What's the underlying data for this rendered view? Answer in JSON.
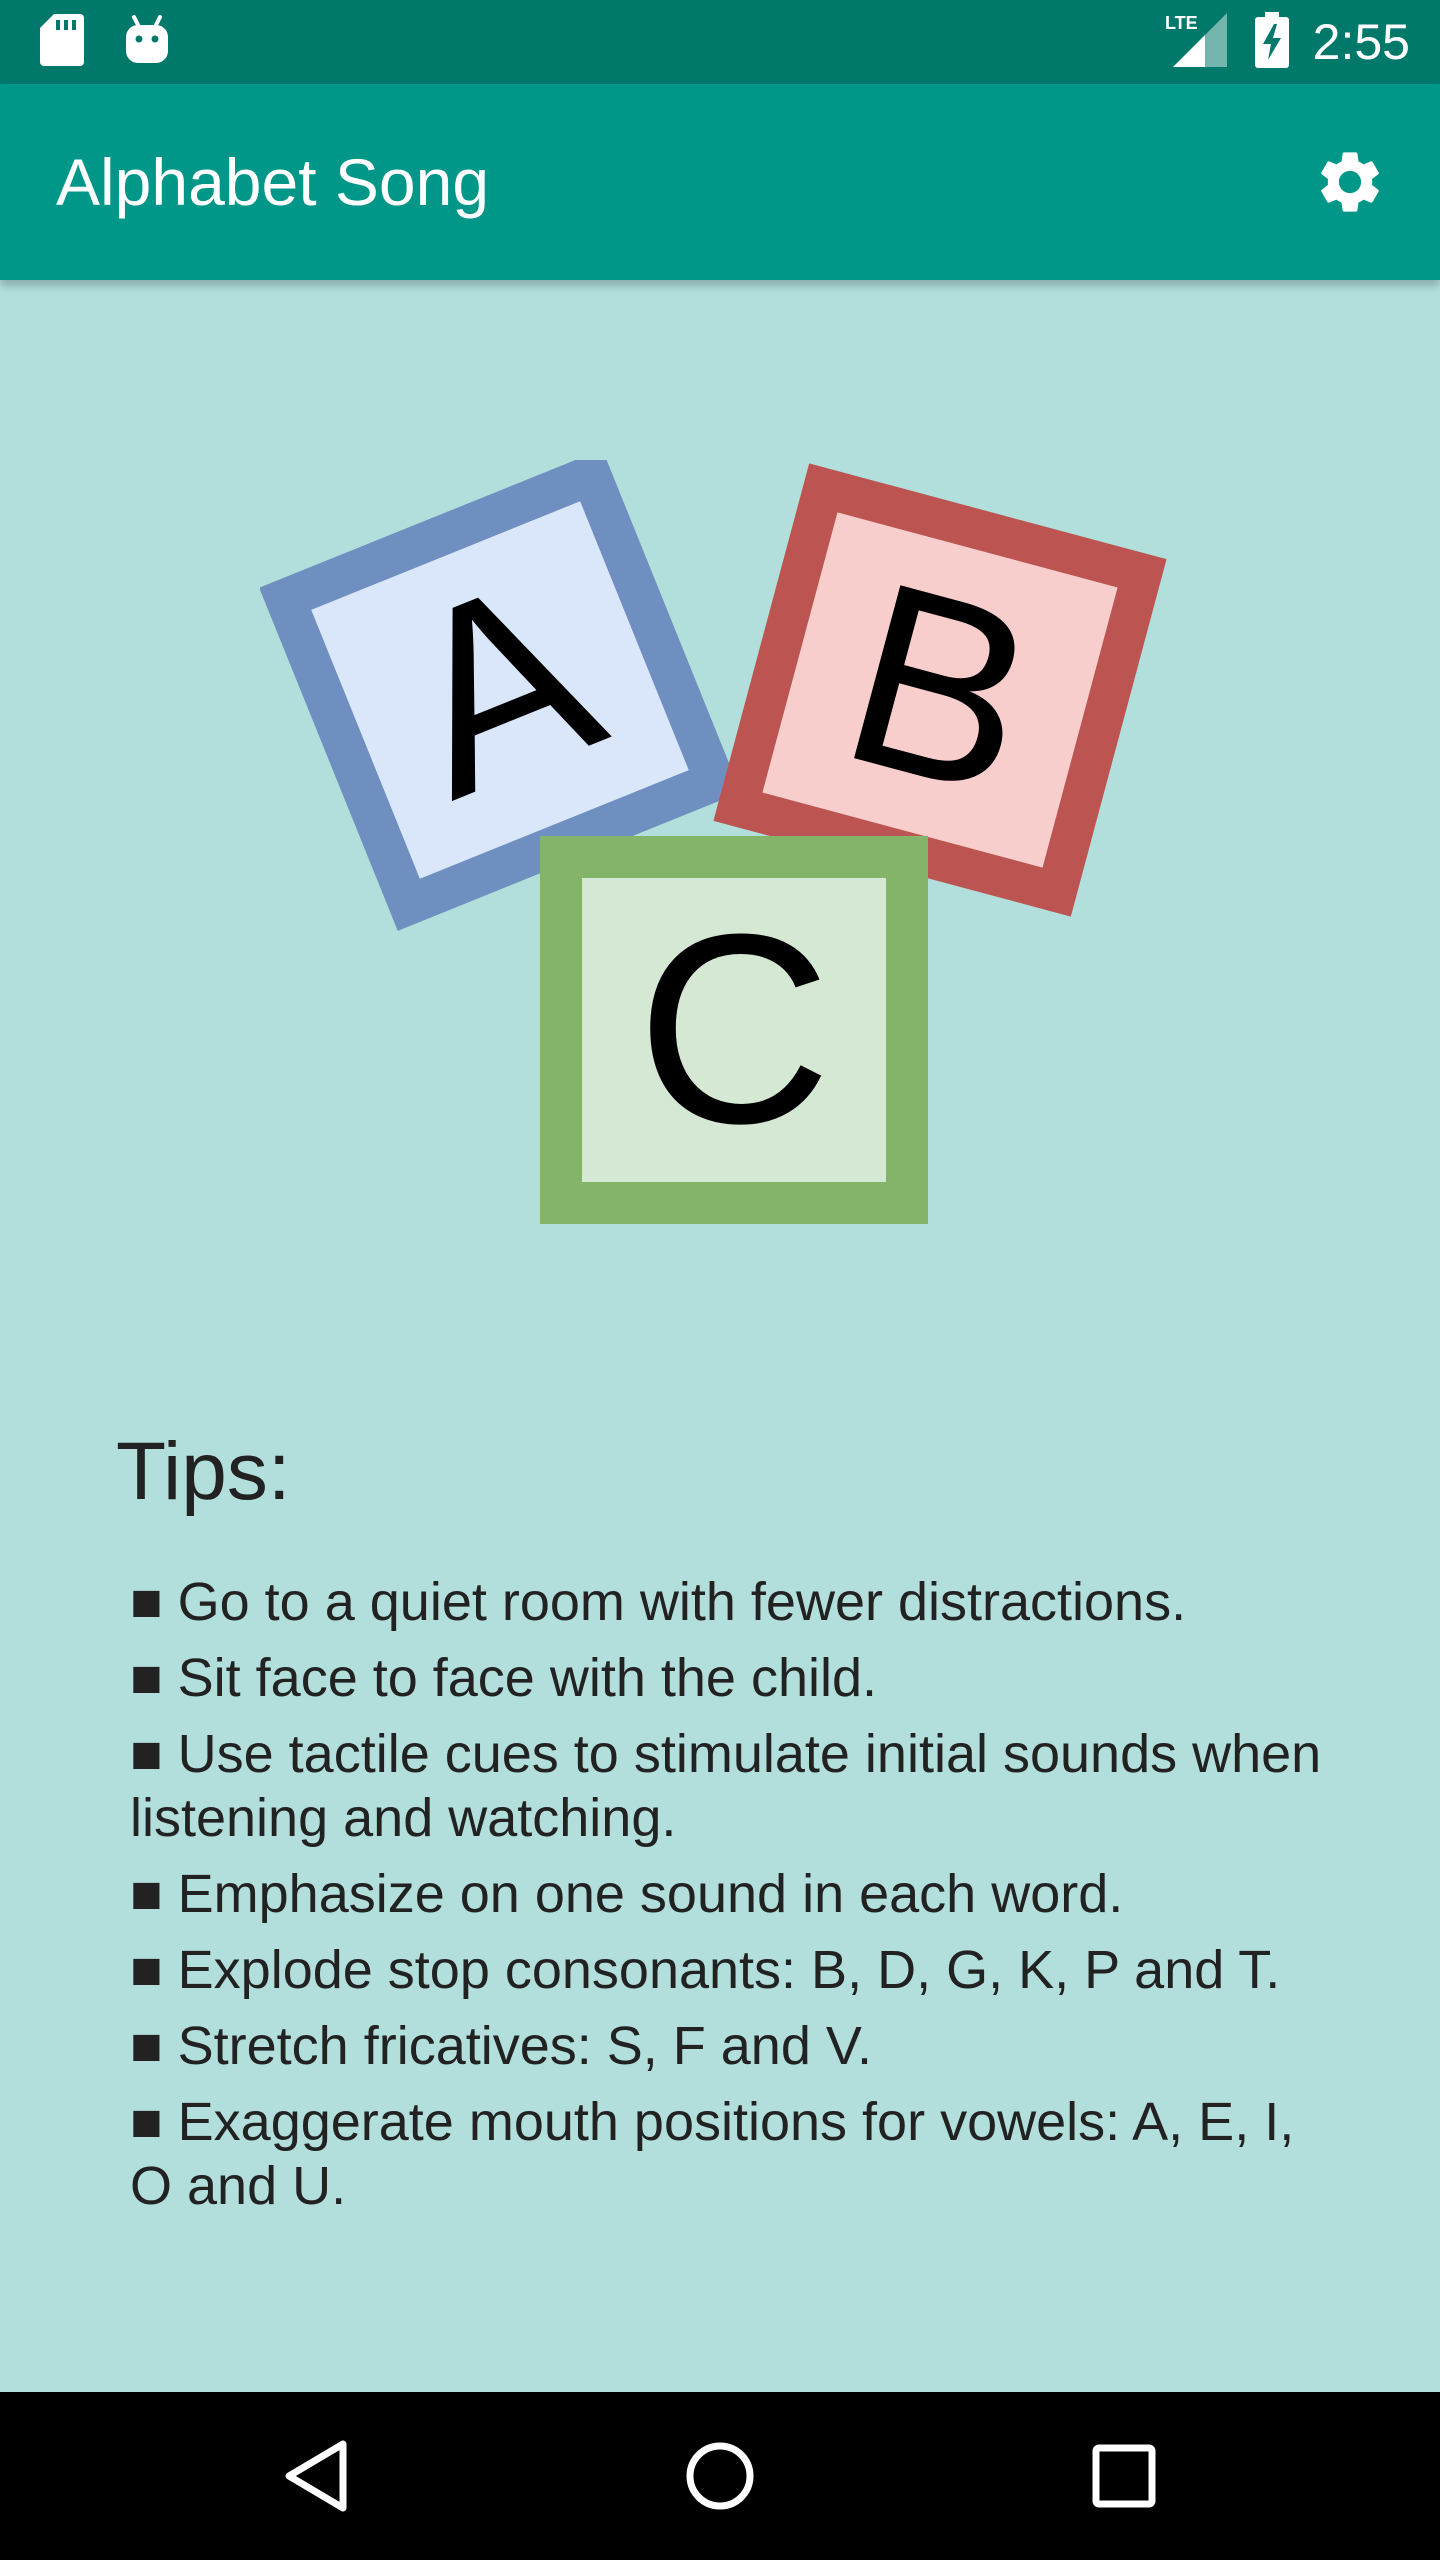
{
  "status_bar": {
    "time": "2:55",
    "network": "LTE",
    "icons": [
      "sd-card-icon",
      "android-icon",
      "lte-signal-icon",
      "battery-charging-icon"
    ]
  },
  "app_bar": {
    "title": "Alphabet Song",
    "settings_icon": "gear-icon"
  },
  "illustration": {
    "blocks": [
      {
        "letter": "A",
        "border": "#6f8fc0",
        "fill": "#dae7fb"
      },
      {
        "letter": "B",
        "border": "#bc5551",
        "fill": "#f8cecc"
      },
      {
        "letter": "C",
        "border": "#84b46a",
        "fill": "#d5e8d4"
      }
    ]
  },
  "tips": {
    "title": "Tips:",
    "bullet": "■",
    "items": [
      "Go to a quiet room with fewer distractions.",
      "Sit face to face with the child.",
      "Use tactile cues to stimulate initial sounds when listening and watching.",
      "Emphasize on one sound in each word.",
      "Explode stop consonants: B, D, G, K, P and T.",
      "Stretch fricatives: S, F and V.",
      "Exaggerate mouth positions for vowels: A, E, I, O and U."
    ]
  },
  "nav_bar": {
    "icons": [
      "back-icon",
      "home-icon",
      "recents-icon"
    ]
  },
  "colors": {
    "status_bar": "#00796b",
    "app_bar": "#009688",
    "background": "#b2dfdb"
  }
}
